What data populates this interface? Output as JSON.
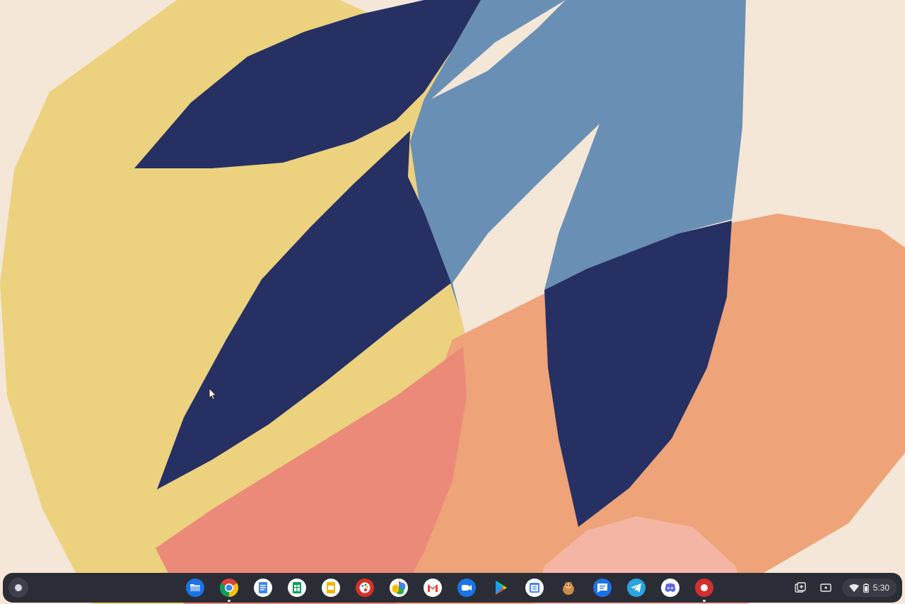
{
  "wallpaper": {
    "background": "#f4e7d8",
    "yellow": "#ecd27f",
    "navy": "#263063",
    "steel_blue": "#6a8fb4",
    "orange": "#eea378",
    "coral": "#eb8a78",
    "pink": "#f4b5a5"
  },
  "shelf": {
    "launcher": {
      "icon": "launcher-circle-icon"
    },
    "apps": [
      {
        "name": "files",
        "icon": "files-folder-icon",
        "color": "#1a73e8",
        "running": false
      },
      {
        "name": "chrome",
        "icon": "chrome-icon",
        "color": "#34a853",
        "running": true
      },
      {
        "name": "docs",
        "icon": "docs-icon",
        "color": "#4285f4",
        "running": false
      },
      {
        "name": "sheets",
        "icon": "sheets-icon",
        "color": "#0f9d58",
        "running": false
      },
      {
        "name": "slides",
        "icon": "slides-icon",
        "color": "#f4b400",
        "running": false
      },
      {
        "name": "canvas",
        "icon": "palette-icon",
        "color": "#d93025",
        "running": false
      },
      {
        "name": "photos",
        "icon": "photos-pinwheel-icon",
        "color": "#fbbc04",
        "running": false
      },
      {
        "name": "gmail",
        "icon": "gmail-icon",
        "color": "#ea4335",
        "running": false
      },
      {
        "name": "duo",
        "icon": "video-call-icon",
        "color": "#1a73e8",
        "running": false
      },
      {
        "name": "play-store",
        "icon": "play-store-icon",
        "color": "#00c853",
        "running": false
      },
      {
        "name": "calendar",
        "icon": "calendar-icon",
        "color": "#4285f4",
        "running": false
      },
      {
        "name": "game",
        "icon": "character-icon",
        "color": "#c98b4a",
        "running": false
      },
      {
        "name": "messages",
        "icon": "messages-icon",
        "color": "#1a73e8",
        "running": false
      },
      {
        "name": "telegram",
        "icon": "telegram-icon",
        "color": "#2aa3e0",
        "running": false
      },
      {
        "name": "discord",
        "icon": "discord-icon",
        "color": "#5865f2",
        "running": false
      },
      {
        "name": "screen-recorder",
        "icon": "record-icon",
        "color": "#d32f2f",
        "running": true
      }
    ],
    "tray": {
      "clipboard": {
        "icon": "clipboard-add-icon"
      },
      "screen_capture": {
        "icon": "screen-capture-icon"
      },
      "wifi": {
        "icon": "wifi-icon"
      },
      "battery": {
        "icon": "battery-icon"
      },
      "time": "5:30"
    }
  }
}
